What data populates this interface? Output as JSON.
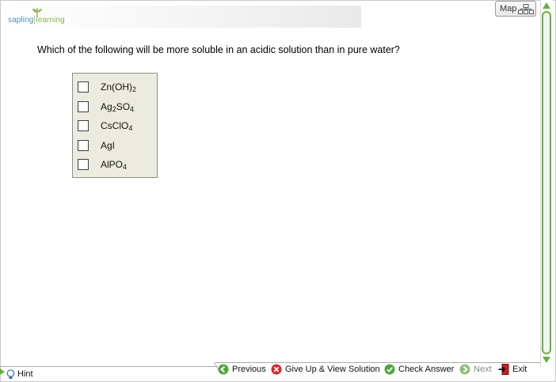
{
  "brand": {
    "word1": "sapling",
    "word2": "learning",
    "sprout_icon": "sprout-icon"
  },
  "map_button": {
    "label": "Map",
    "icon": "sitemap-icon"
  },
  "question": {
    "text": "Which of the following will be more soluble in an acidic solution than in pure water?"
  },
  "choices": [
    {
      "label": [
        {
          "t": "Zn(OH)"
        },
        {
          "t": "2",
          "sub": true
        }
      ],
      "checked": false
    },
    {
      "label": [
        {
          "t": "Ag"
        },
        {
          "t": "2",
          "sub": true
        },
        {
          "t": "SO"
        },
        {
          "t": "4",
          "sub": true
        }
      ],
      "checked": false
    },
    {
      "label": [
        {
          "t": "CsClO"
        },
        {
          "t": "4",
          "sub": true
        }
      ],
      "checked": false
    },
    {
      "label": [
        {
          "t": "AgI"
        }
      ],
      "checked": false
    },
    {
      "label": [
        {
          "t": "AlPO"
        },
        {
          "t": "4",
          "sub": true
        }
      ],
      "checked": false
    }
  ],
  "nav": {
    "previous": {
      "label": "Previous",
      "icon": "green-back-arrow-icon"
    },
    "give_up": {
      "label": "Give Up & View Solution",
      "icon": "red-x-circle-icon"
    },
    "check": {
      "label": "Check Answer",
      "icon": "green-check-circle-icon"
    },
    "next": {
      "label": "Next",
      "icon": "green-forward-arrow-icon",
      "disabled": true
    },
    "exit": {
      "label": "Exit",
      "icon": "exit-door-icon"
    }
  },
  "hint": {
    "label": "Hint",
    "icon": "lightbulb-icon"
  },
  "colors": {
    "accent_green": "#68b13c",
    "panel_bg": "#ecebdf",
    "logo_blue": "#4a8fb5",
    "logo_green": "#8ab24d"
  }
}
